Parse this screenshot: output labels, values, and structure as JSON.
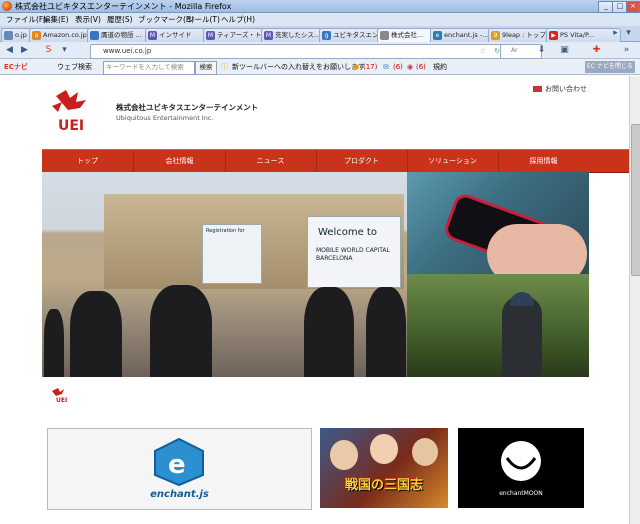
{
  "window": {
    "title": "株式会社ユビキタスエンターテインメント - Mozilla Firefox"
  },
  "menu": [
    "ファイル(F)",
    "編集(E)",
    "表示(V)",
    "履歴(S)",
    "ブックマーク(B)",
    "ツール(T)",
    "ヘルプ(H)"
  ],
  "tabs": [
    {
      "label": "o.jp",
      "icon": "page-icon",
      "color": "#6a87b8"
    },
    {
      "label": "Amazon.co.jp",
      "icon": "amazon-icon",
      "color": "#e08a1e"
    },
    {
      "label": "贋道の物語 ...",
      "icon": "bookmark-icon",
      "color": "#3a74c4"
    },
    {
      "label": "インサイド",
      "icon": "mail-icon",
      "color": "#6357b5"
    },
    {
      "label": "ティアーズ・トゥ...",
      "icon": "mail-icon",
      "color": "#6357b5"
    },
    {
      "label": "充実したシス...",
      "icon": "mail-icon",
      "color": "#6357b5"
    },
    {
      "label": "ユビキタスエン...",
      "icon": "google-icon",
      "color": "#3a74c4"
    },
    {
      "label": "株式会社...",
      "icon": "page-icon",
      "color": "#888888"
    },
    {
      "label": "enchant.js -...",
      "icon": "enchant-icon",
      "color": "#2b7ab8"
    },
    {
      "label": "9leap : トップ...",
      "icon": "leap-icon",
      "color": "#e09d1a"
    },
    {
      "label": "PS Vita/P...",
      "icon": "youtube-icon",
      "color": "#d8261c"
    }
  ],
  "nav": {
    "url": "www.uei.co.jp",
    "search_placeholder": "Ar"
  },
  "toolbar2": {
    "ec_label": "ECナビ",
    "web_search": "ウェブ検索",
    "keyword_placeholder": "キーワードを入力して検索",
    "search_button": "検索",
    "notice": "新ツールバーへの入れ替えをお願いします",
    "count1": "(17)",
    "count2": "(6)",
    "count3": "(6)",
    "rules": "規約",
    "dismiss": "EC ナビを閉じる"
  },
  "page": {
    "company_ja": "株式会社ユビキタスエンターテインメント",
    "company_en": "Ubiquitous Entertainment Inc.",
    "logo_text": "UEI",
    "contact": "お問い合わせ",
    "nav": [
      "トップ",
      "会社情報",
      "ニュース",
      "プロダクト",
      "ソリューション",
      "採用情報"
    ],
    "hero": {
      "banner_welcome": "Welcome to",
      "banner_event": "MOBILE WORLD CAPITAL BARCELONA",
      "banner_reg": "Registration for"
    },
    "cards": {
      "enchant": "enchant.js",
      "game": "戦国の三国志",
      "moon": "enchantMOON"
    }
  },
  "colors": {
    "accent": "#c9331a",
    "menu_bg": "#dbe6f4"
  }
}
